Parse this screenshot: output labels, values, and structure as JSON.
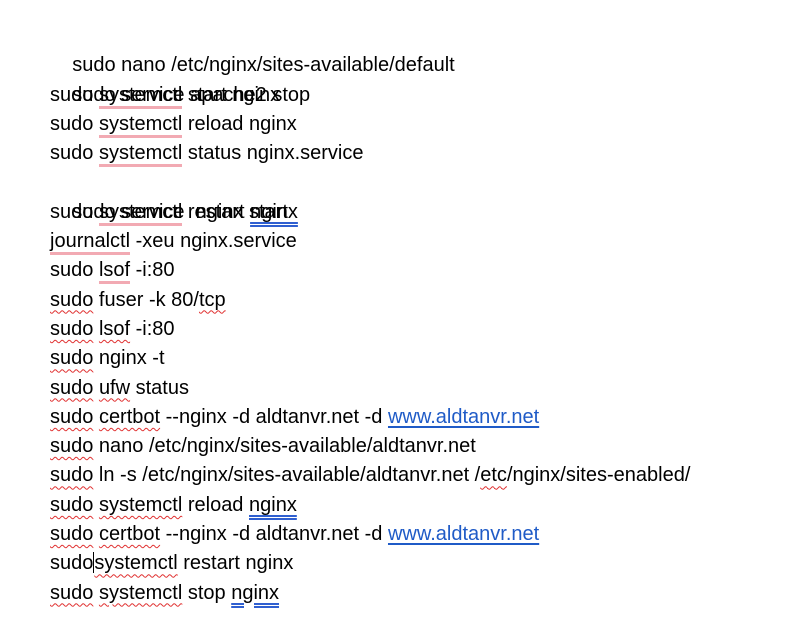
{
  "document": {
    "lines": [
      "sudo nano /etc/nginx/sites-available/default",
      "sudo service apache2 stop",
      "sudo systemctl start nginx",
      "sudo systemctl reload nginx",
      "sudo systemctl status nginx.service",
      "sudo service  nginx start",
      "sudo systemctl restart nginx",
      "journalctl -xeu nginx.service",
      "sudo lsof -i:80",
      "sudo fuser -k 80/tcp",
      "sudo lsof -i:80",
      "sudo nginx -t",
      "sudo ufw status",
      "sudo certbot --nginx -d aldtanvr.net -d www.aldtanvr.net",
      "sudo nano /etc/nginx/sites-available/aldtanvr.net",
      "sudo ln -s /etc/nginx/sites-available/aldtanvr.net /etc/nginx/sites-enabled/",
      "sudo systemctl reload nginx",
      "sudo certbot --nginx -d aldtanvr.net -d www.aldtanvr.net",
      "sudo systemctl restart nginx",
      "sudo systemctl stop nginx"
    ],
    "link_text": "www.aldtanvr.net"
  },
  "colors": {
    "text": "#000000",
    "link": "#1f5bc7",
    "spelling_underline": "#e03030",
    "grammar_underline": "#f2aab3",
    "style_underline": "#2f5fd0"
  }
}
